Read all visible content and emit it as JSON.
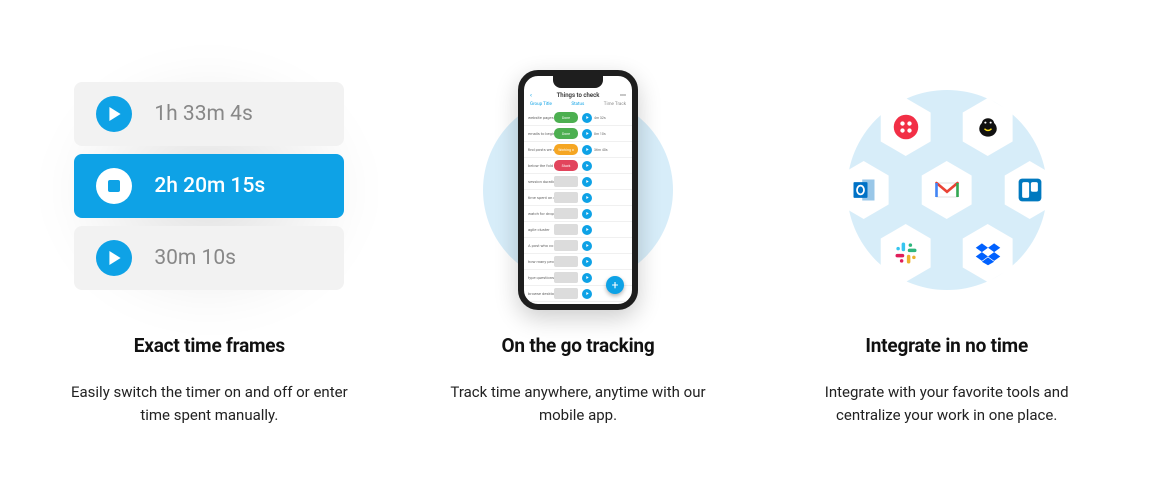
{
  "features": [
    {
      "title": "Exact time frames",
      "description": "Easily switch the timer on and off or enter time spent manually."
    },
    {
      "title": "On the go tracking",
      "description": "Track time anywhere, anytime with our mobile app."
    },
    {
      "title": "Integrate in no time",
      "description": "Integrate with your favorite tools and centralize your work in one place."
    }
  ],
  "timers": [
    {
      "time": "1h 33m 4s",
      "state": "idle"
    },
    {
      "time": "2h 20m 15s",
      "state": "active"
    },
    {
      "time": "30m 10s",
      "state": "idle"
    }
  ],
  "phone": {
    "title": "Things to check",
    "subLeft": "Group Title",
    "subMid": "Status",
    "subRight": "Time Track",
    "rows": [
      {
        "label": "website pages",
        "status": "Done",
        "statusColor": "#4caf50",
        "time": "4m 32s"
      },
      {
        "label": "emails to beginn",
        "status": "Done",
        "statusColor": "#4caf50",
        "time": "8m 10s"
      },
      {
        "label": "find posts we wr",
        "status": "Working o",
        "statusColor": "#f5a623",
        "time": "36m 40s"
      },
      {
        "label": "below the fold re",
        "status": "Stuck",
        "statusColor": "#e2445c",
        "time": ""
      },
      {
        "label": "session duration",
        "status": "",
        "time": ""
      },
      {
        "label": "time spent on e",
        "status": "",
        "time": ""
      },
      {
        "label": "watch for drop su",
        "status": "",
        "time": ""
      },
      {
        "label": "agile cluster",
        "status": "",
        "time": ""
      },
      {
        "label": "A post who co",
        "status": "",
        "time": ""
      },
      {
        "label": "how many peopl",
        "status": "",
        "time": ""
      },
      {
        "label": "type questions",
        "status": "",
        "time": ""
      },
      {
        "label": "browse desktop",
        "status": "",
        "time": ""
      }
    ]
  },
  "integrations": {
    "center": "gmail",
    "tl": "twilio",
    "tr": "mailchimp",
    "ml": "outlook",
    "mr": "trello",
    "bl": "slack",
    "br": "dropbox"
  }
}
